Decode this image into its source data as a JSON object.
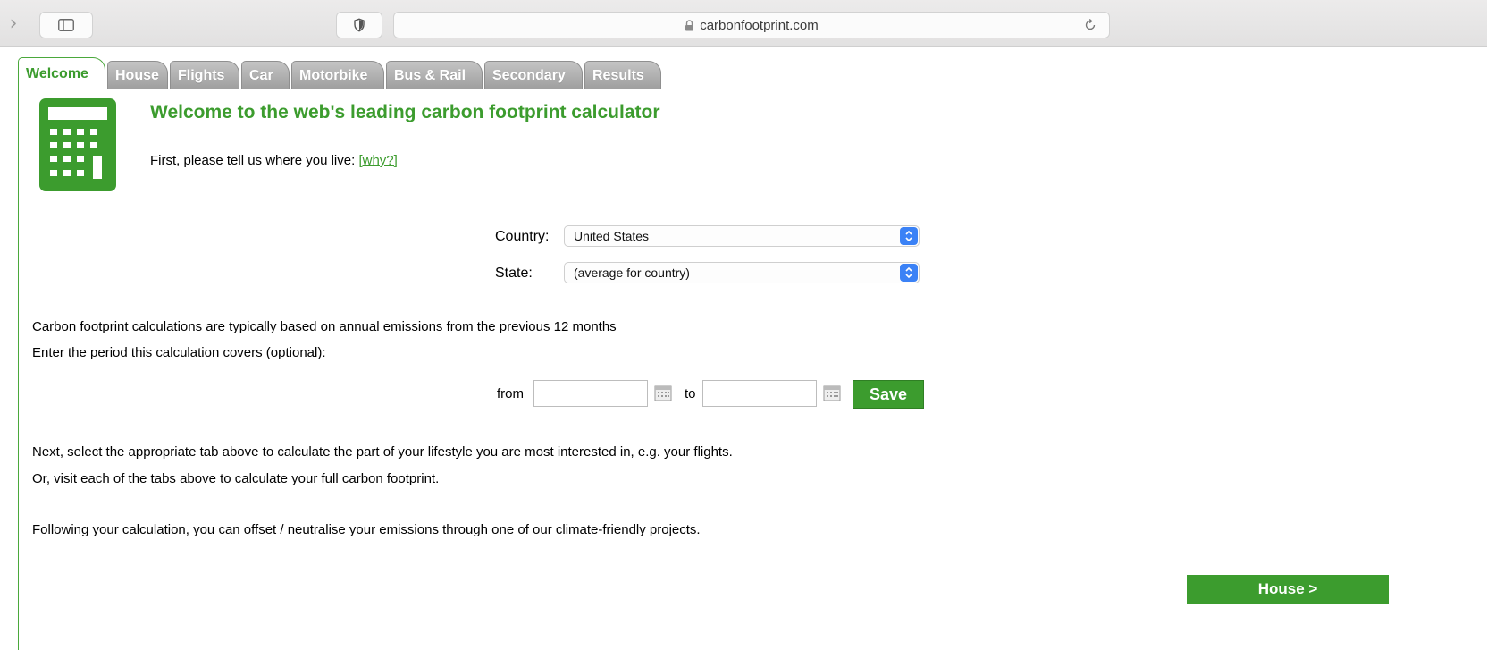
{
  "browser": {
    "url": "carbonfootprint.com",
    "back_icon": "chevron-right-icon",
    "sidebar_icon": "sidebar-icon",
    "privacy_icon": "shield-icon",
    "lock_icon": "lock-icon",
    "reload_icon": "reload-icon"
  },
  "tabs": [
    {
      "label": "Welcome",
      "active": true
    },
    {
      "label": "House",
      "active": false
    },
    {
      "label": "Flights",
      "active": false
    },
    {
      "label": "Car",
      "active": false
    },
    {
      "label": "Motorbike",
      "active": false
    },
    {
      "label": "Bus & Rail",
      "active": false
    },
    {
      "label": "Secondary",
      "active": false
    },
    {
      "label": "Results",
      "active": false
    }
  ],
  "colors": {
    "brand_green": "#3c9c2e",
    "tab_inactive": "#b0b0b0",
    "select_arrow": "#3b82f6"
  },
  "main": {
    "heading": "Welcome to the web's leading carbon footprint calculator",
    "intro": "First, please tell us where you live:",
    "why_link": "[why?]",
    "country_label": "Country:",
    "country_value": "United States",
    "state_label": "State:",
    "state_value": "(average for country)",
    "period_note": "Carbon footprint calculations are typically based on annual emissions from the previous 12 months",
    "period_prompt": "Enter the period this calculation covers (optional):",
    "from_label": "from",
    "to_label": "to",
    "from_value": "",
    "to_value": "",
    "save_label": "Save",
    "next_text": "Next, select the appropriate tab above to calculate the part of your lifestyle you are most interested in, e.g. your flights.",
    "or_text": "Or, visit each of the tabs above to calculate your full carbon footprint.",
    "offset_text": "Following your calculation, you can offset / neutralise your emissions through one of our climate-friendly projects.",
    "next_button": "House >"
  }
}
